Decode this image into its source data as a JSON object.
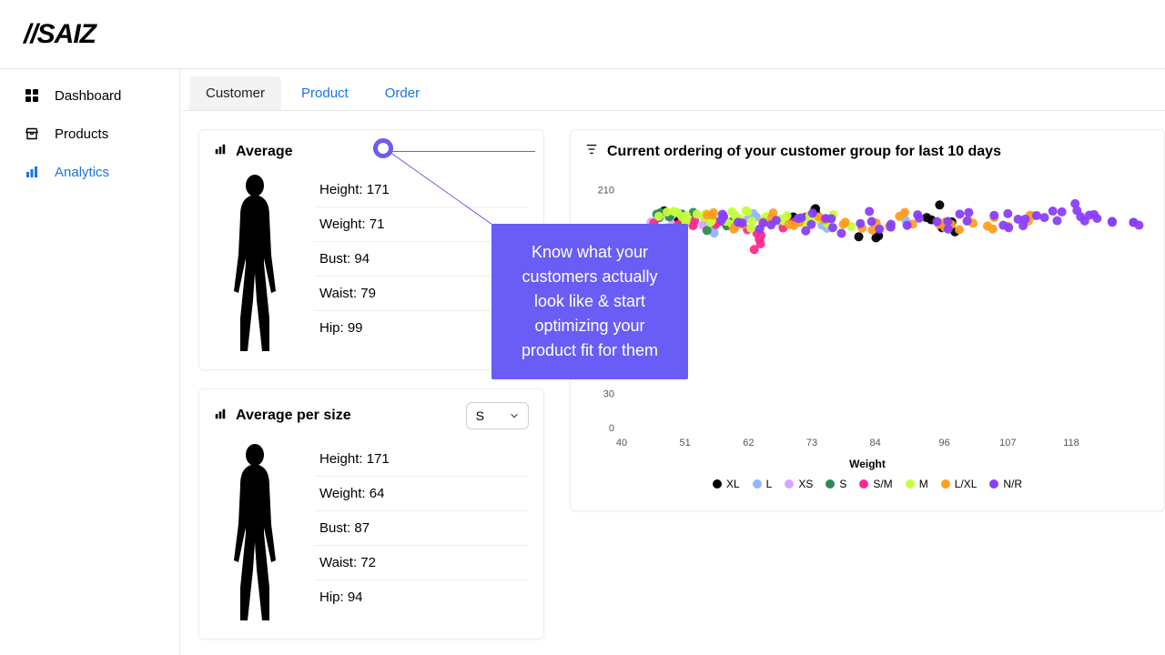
{
  "brand": "//SAIZ",
  "sidebar": {
    "items": [
      {
        "label": "Dashboard",
        "icon": "grid"
      },
      {
        "label": "Products",
        "icon": "products"
      },
      {
        "label": "Analytics",
        "icon": "bars",
        "active": true
      }
    ]
  },
  "tabs": [
    {
      "label": "Customer",
      "active": true
    },
    {
      "label": "Product",
      "active": false
    },
    {
      "label": "Order",
      "active": false
    }
  ],
  "average_card": {
    "title": "Average",
    "rows": [
      {
        "label": "Height",
        "value": "171"
      },
      {
        "label": "Weight",
        "value": "71"
      },
      {
        "label": "Bust",
        "value": "94"
      },
      {
        "label": "Waist",
        "value": "79"
      },
      {
        "label": "Hip",
        "value": "99"
      }
    ]
  },
  "average_per_size_card": {
    "title": "Average per size",
    "selected_size": "S",
    "rows": [
      {
        "label": "Height",
        "value": "171"
      },
      {
        "label": "Weight",
        "value": "64"
      },
      {
        "label": "Bust",
        "value": "87"
      },
      {
        "label": "Waist",
        "value": "72"
      },
      {
        "label": "Hip",
        "value": "94"
      }
    ]
  },
  "tooltip_text": "Know what your customers actually look like & start optimizing your product fit for them",
  "chart": {
    "title": "Current ordering of your customer group for last 10 days",
    "xlabel": "Weight",
    "legend": [
      {
        "name": "XL",
        "color": "#000000"
      },
      {
        "name": "L",
        "color": "#8fb8ff"
      },
      {
        "name": "XS",
        "color": "#d6a6ff"
      },
      {
        "name": "S",
        "color": "#2e8b57"
      },
      {
        "name": "S/M",
        "color": "#ff2b8d"
      },
      {
        "name": "M",
        "color": "#c4ff3d"
      },
      {
        "name": "L/XL",
        "color": "#ff9e1f"
      },
      {
        "name": "N/R",
        "color": "#8a3ffc"
      }
    ]
  },
  "chart_data": {
    "type": "scatter",
    "title": "Current ordering of your customer group for last 10 days",
    "xlabel": "Weight",
    "ylabel": "",
    "xlim": [
      40,
      130
    ],
    "ylim": [
      0,
      220
    ],
    "xticks": [
      40,
      51,
      62,
      73,
      84,
      96,
      107,
      118
    ],
    "yticks": [
      0,
      30,
      210
    ],
    "series": [
      {
        "name": "XL",
        "color": "#000000",
        "points": [
          [
            49,
            185
          ],
          [
            71,
            180
          ],
          [
            73,
            190
          ],
          [
            83,
            165
          ],
          [
            94,
            190
          ],
          [
            96,
            175
          ]
        ]
      },
      {
        "name": "L",
        "color": "#8fb8ff",
        "points": [
          [
            54,
            182
          ],
          [
            58,
            178
          ],
          [
            62,
            186
          ],
          [
            68,
            183
          ],
          [
            75,
            180
          ],
          [
            88,
            182
          ]
        ]
      },
      {
        "name": "XS",
        "color": "#d6a6ff",
        "points": [
          [
            47,
            180
          ],
          [
            50,
            185
          ],
          [
            53,
            182
          ],
          [
            60,
            178
          ]
        ]
      },
      {
        "name": "S",
        "color": "#2e8b57",
        "points": [
          [
            45,
            183
          ],
          [
            48,
            180
          ],
          [
            52,
            185
          ],
          [
            55,
            178
          ],
          [
            58,
            182
          ]
        ]
      },
      {
        "name": "S/M",
        "color": "#ff2b8d",
        "points": [
          [
            46,
            180
          ],
          [
            51,
            178
          ],
          [
            56,
            183
          ],
          [
            63,
            175
          ],
          [
            70,
            182
          ],
          [
            64,
            160
          ]
        ]
      },
      {
        "name": "M",
        "color": "#c4ff3d",
        "points": [
          [
            48,
            190
          ],
          [
            50,
            186
          ],
          [
            52,
            183
          ],
          [
            55,
            188
          ],
          [
            57,
            180
          ],
          [
            59,
            185
          ],
          [
            61,
            182
          ],
          [
            63,
            187
          ],
          [
            65,
            180
          ],
          [
            67,
            184
          ],
          [
            70,
            181
          ],
          [
            72,
            186
          ],
          [
            74,
            182
          ],
          [
            76,
            185
          ],
          [
            78,
            180
          ]
        ]
      },
      {
        "name": "L/XL",
        "color": "#ff9e1f",
        "points": [
          [
            55,
            185
          ],
          [
            60,
            180
          ],
          [
            65,
            184
          ],
          [
            70,
            178
          ],
          [
            75,
            186
          ],
          [
            80,
            182
          ],
          [
            85,
            180
          ],
          [
            90,
            184
          ],
          [
            95,
            182
          ],
          [
            98,
            178
          ],
          [
            102,
            183
          ],
          [
            106,
            180
          ],
          [
            110,
            184
          ]
        ]
      },
      {
        "name": "N/R",
        "color": "#8a3ffc",
        "points": [
          [
            58,
            182
          ],
          [
            62,
            178
          ],
          [
            66,
            185
          ],
          [
            70,
            180
          ],
          [
            74,
            183
          ],
          [
            78,
            178
          ],
          [
            82,
            184
          ],
          [
            86,
            180
          ],
          [
            90,
            182
          ],
          [
            95,
            178
          ],
          [
            100,
            185
          ],
          [
            105,
            183
          ],
          [
            108,
            180
          ],
          [
            112,
            184
          ],
          [
            115,
            188
          ],
          [
            118,
            192
          ],
          [
            120,
            183
          ],
          [
            124,
            186
          ],
          [
            128,
            184
          ]
        ]
      }
    ]
  }
}
